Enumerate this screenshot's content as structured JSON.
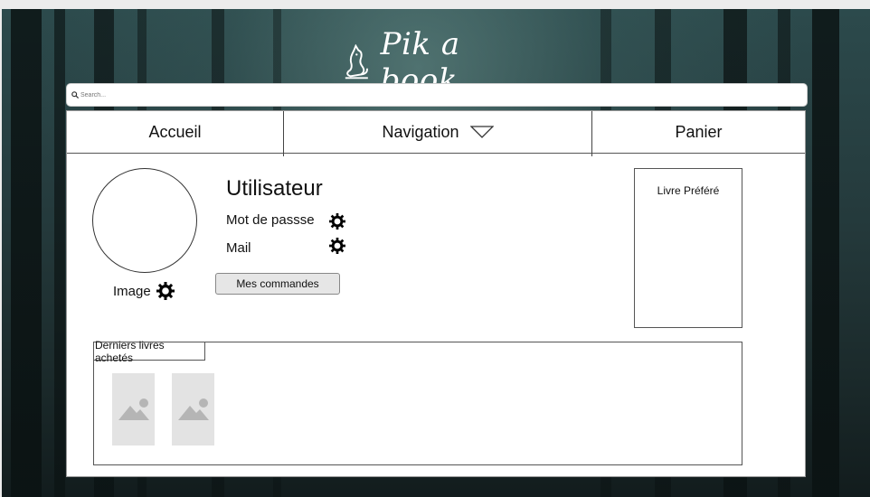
{
  "brand": {
    "name": "Pik a book",
    "logo_icon": "cat-logo-icon"
  },
  "search": {
    "placeholder": "Search...",
    "icon": "search-icon"
  },
  "nav": {
    "items": [
      {
        "label": "Accueil"
      },
      {
        "label": "Navigation",
        "icon": "chevron-down-icon"
      },
      {
        "label": "Panier"
      }
    ]
  },
  "profile": {
    "username": "Utilisateur",
    "password_label": "Mot de passse",
    "mail_label": "Mail",
    "image_label": "Image",
    "orders_button": "Mes commandes",
    "settings_icon": "gear-icon"
  },
  "favorite": {
    "label": "Livre Préféré"
  },
  "recent": {
    "label": "Derniers livres achetés",
    "books": [
      {
        "icon": "image-placeholder-icon"
      },
      {
        "icon": "image-placeholder-icon"
      }
    ]
  }
}
